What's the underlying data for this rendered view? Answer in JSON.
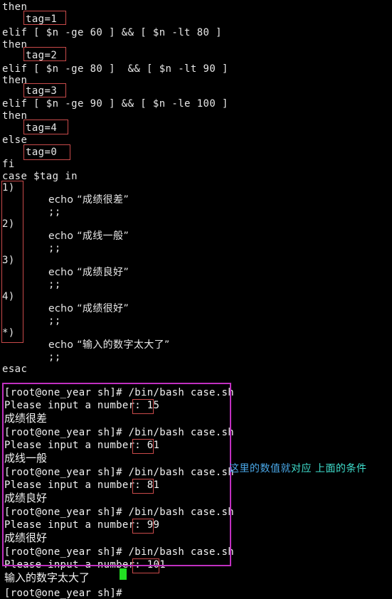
{
  "script": {
    "lines": [
      {
        "text": "then",
        "indent": 0,
        "cjk": false
      },
      {
        "text": "tag=1",
        "indent": 1,
        "cjk": false
      },
      {
        "text": "elif [ $n -ge 60 ] && [ $n -lt 80 ]",
        "indent": 0,
        "cjk": false
      },
      {
        "text": "then",
        "indent": 0,
        "cjk": false
      },
      {
        "text": "tag=2",
        "indent": 1,
        "cjk": false
      },
      {
        "text": "elif [ $n -ge 80 ]  && [ $n -lt 90 ]",
        "indent": 0,
        "cjk": false
      },
      {
        "text": "then",
        "indent": 0,
        "cjk": false
      },
      {
        "text": "tag=3",
        "indent": 1,
        "cjk": false
      },
      {
        "text": "elif [ $n -ge 90 ] && [ $n -le 100 ]",
        "indent": 0,
        "cjk": false
      },
      {
        "text": "then",
        "indent": 0,
        "cjk": false
      },
      {
        "text": "tag=4",
        "indent": 1,
        "cjk": false
      },
      {
        "text": "else",
        "indent": 0,
        "cjk": false
      },
      {
        "text": "tag=0",
        "indent": 1,
        "cjk": false
      },
      {
        "text": "fi",
        "indent": 0,
        "cjk": false
      },
      {
        "text": "case $tag in",
        "indent": 0,
        "cjk": false
      },
      {
        "text": "1)",
        "indent": 0,
        "cjk": false
      },
      {
        "text": "echo “成绩很差”",
        "indent": 2,
        "cjk": true
      },
      {
        "text": ";;",
        "indent": 2,
        "cjk": false
      },
      {
        "text": "2)",
        "indent": 0,
        "cjk": false
      },
      {
        "text": "echo “成线一般”",
        "indent": 2,
        "cjk": true
      },
      {
        "text": ";;",
        "indent": 2,
        "cjk": false
      },
      {
        "text": "3)",
        "indent": 0,
        "cjk": false
      },
      {
        "text": "echo “成绩良好”",
        "indent": 2,
        "cjk": true
      },
      {
        "text": ";;",
        "indent": 2,
        "cjk": false
      },
      {
        "text": "4)",
        "indent": 0,
        "cjk": false
      },
      {
        "text": "echo “成绩很好”",
        "indent": 2,
        "cjk": true
      },
      {
        "text": ";;",
        "indent": 2,
        "cjk": false
      },
      {
        "text": "*)",
        "indent": 0,
        "cjk": false
      },
      {
        "text": "echo “输入的数字太大了”",
        "indent": 2,
        "cjk": true
      },
      {
        "text": ";;",
        "indent": 2,
        "cjk": false
      },
      {
        "text": "esac",
        "indent": 0,
        "cjk": false
      }
    ],
    "highlight_values": [
      "tag=1",
      "tag=2",
      "tag=3",
      "tag=4",
      "tag=0"
    ],
    "case_patterns": [
      "1)",
      "2)",
      "3)",
      "4)",
      "*)"
    ]
  },
  "terminal": {
    "prompt": "[root@one_year sh]# ",
    "command": "/bin/bash case.sh",
    "input_prompt": "Please input a number: ",
    "sessions": [
      {
        "input": "15",
        "output": "成绩很差"
      },
      {
        "input": "61",
        "output": "成线一般"
      },
      {
        "input": "81",
        "output": "成绩良好"
      },
      {
        "input": "99",
        "output": "成绩很好"
      },
      {
        "input": "101",
        "output": "输入的数字太大了"
      }
    ],
    "final_prompt": "[root@one_year sh]# ",
    "cursor": "block"
  },
  "annotation": {
    "part_a": "这里的数值就",
    "part_b": "对应 上面的条件",
    "full_text": "这里的数值就对应 上面的条件"
  },
  "colors": {
    "background": "#000000",
    "text": "#f0f0f0",
    "highlight_box": "#c94a4a",
    "session_box": "#c030c0",
    "annotation_blue": "#4aa8e8",
    "annotation_cyan": "#3fe0cf",
    "cursor": "#22dd22"
  }
}
